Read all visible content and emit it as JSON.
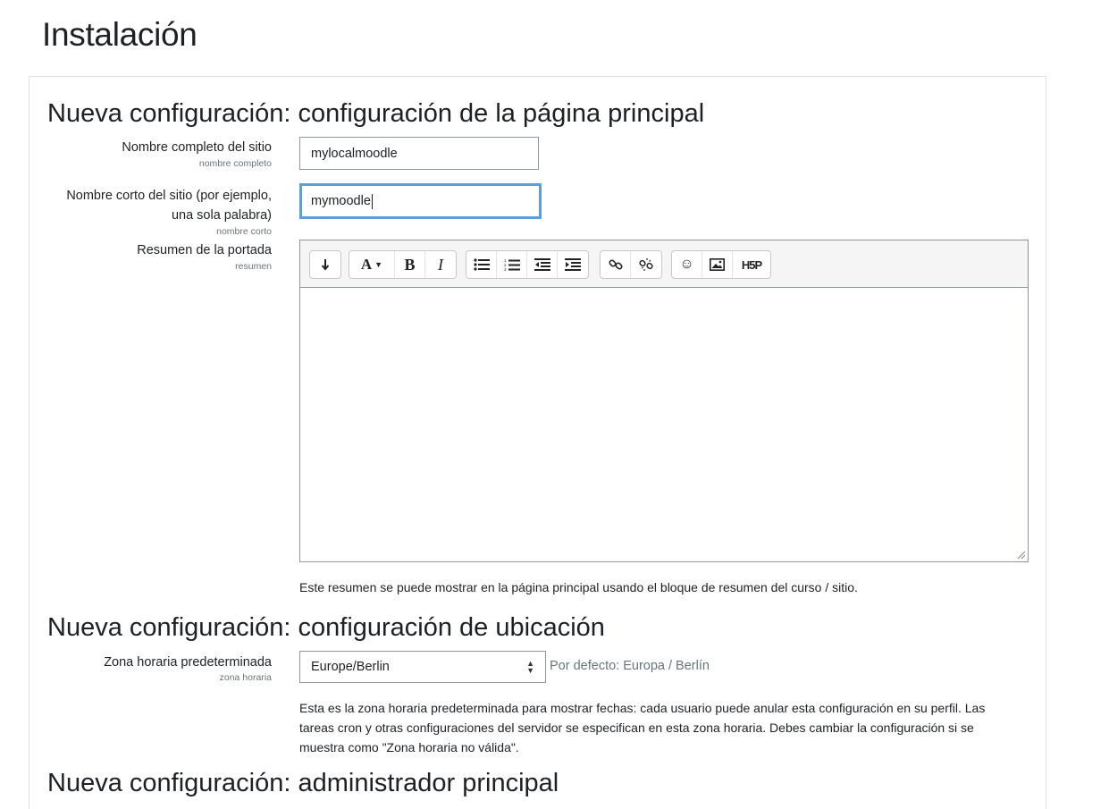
{
  "page_title": "Instalación",
  "section1": {
    "heading": "Nueva configuración: configuración de la página principal",
    "fullname": {
      "label": "Nombre completo del sitio",
      "sublabel": "nombre completo",
      "value": "mylocalmoodle"
    },
    "shortname": {
      "label_line1": "Nombre corto del sitio (por ejemplo,",
      "label_line2": "una sola palabra)",
      "sublabel": "nombre corto",
      "value": "mymoodle"
    },
    "summary": {
      "label": "Resumen de la portada",
      "sublabel": "resumen",
      "toolbar": [
        [
          "expand-toolbar-icon"
        ],
        [
          "font-style-icon",
          "bold-icon",
          "italic-icon"
        ],
        [
          "unordered-list-icon",
          "ordered-list-icon",
          "outdent-icon",
          "indent-icon"
        ],
        [
          "link-icon",
          "unlink-icon"
        ],
        [
          "emoji-icon",
          "image-icon",
          "h5p-icon"
        ]
      ],
      "help": "Este resumen se puede mostrar en la página principal usando el bloque de resumen del curso / sitio."
    }
  },
  "section2": {
    "heading": "Nueva configuración: configuración de ubicación",
    "timezone": {
      "label": "Zona horaria predeterminada",
      "sublabel": "zona horaria",
      "value": "Europe/Berlin",
      "default_text": "Por defecto: Europa / Berlín",
      "help_line1": "Esta es la zona horaria predeterminada para mostrar fechas: cada usuario puede anular esta configuración en su perfil. Las",
      "help_line2": "tareas cron y otras configuraciones del servidor se especifican en esta zona horaria. Debes cambiar la configuración si se",
      "help_line3": "muestra como \"Zona horaria no válida\"."
    }
  },
  "section3": {
    "heading_partial": "Nueva configuración: administrador principal"
  }
}
